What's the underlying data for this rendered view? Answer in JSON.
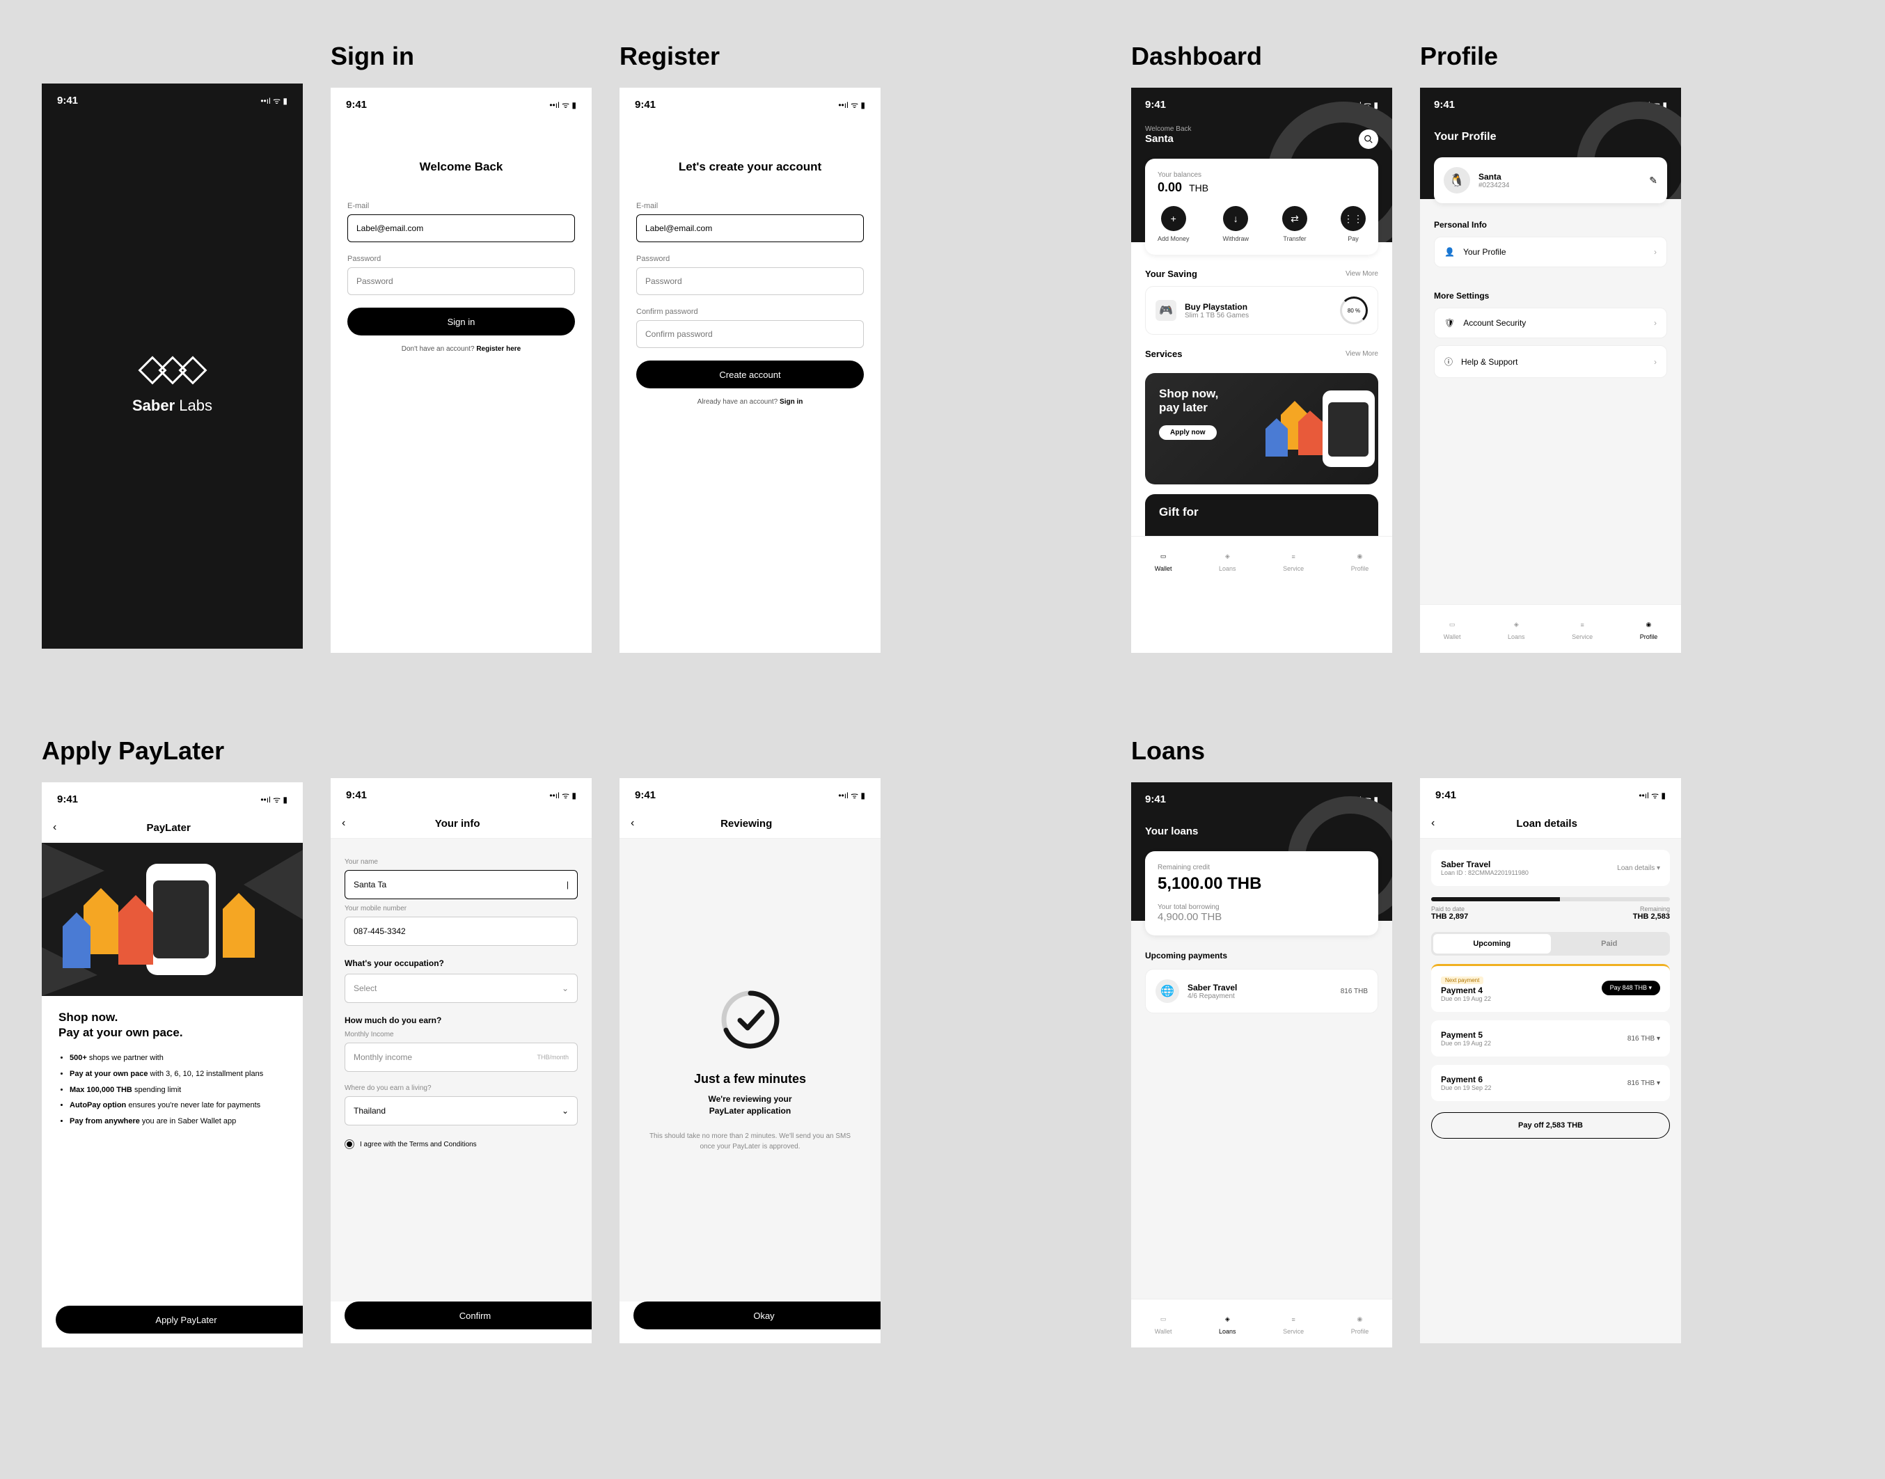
{
  "status": {
    "time": "9:41",
    "icons": "􀙇 􀛨"
  },
  "splash": {
    "brand": "Saber",
    "brand2": "Labs"
  },
  "titles": {
    "signin": "Sign in",
    "register": "Register",
    "dashboard": "Dashboard",
    "profile": "Profile",
    "applyPL": "Apply PayLater",
    "loans": "Loans"
  },
  "signin": {
    "heading": "Welcome Back",
    "email_label": "E-mail",
    "email_value": "Label@email.com",
    "password_label": "Password",
    "password_placeholder": "Password",
    "submit": "Sign in",
    "hint": "Don't have an account? ",
    "hint_link": "Register here"
  },
  "register": {
    "heading": "Let's create your account",
    "email_label": "E-mail",
    "email_value": "Label@email.com",
    "password_label": "Password",
    "password_placeholder": "Password",
    "confirm_label": "Confirm password",
    "confirm_placeholder": "Confirm password",
    "submit": "Create account",
    "hint": "Already have an account? ",
    "hint_link": "Sign in"
  },
  "dashboard": {
    "welcome": "Welcome Back",
    "name": "Santa",
    "balance_label": "Your balances",
    "balance": "0.00",
    "currency": "THB",
    "actions": [
      {
        "icon": "+",
        "label": "Add Money"
      },
      {
        "icon": "↓",
        "label": "Withdraw"
      },
      {
        "icon": "⇄",
        "label": "Transfer"
      },
      {
        "icon": "⋮⋮",
        "label": "Pay"
      }
    ],
    "saving_title": "Your Saving",
    "view_more": "View More",
    "saving": {
      "name": "Buy Playstation",
      "sub": "Slim 1 TB 56 Games",
      "pct": "80 %"
    },
    "services_title": "Services",
    "banner_line1": "Shop now,",
    "banner_line2": "pay later",
    "banner_cta": "Apply now",
    "banner2_title": "Gift for",
    "nav": [
      "Wallet",
      "Loans",
      "Service",
      "Profile"
    ],
    "nav_active": 0
  },
  "profile": {
    "title": "Your Profile",
    "name": "Santa",
    "id": "#0234234",
    "personal_title": "Personal Info",
    "item1": "Your Profile",
    "more_title": "More Settings",
    "item2": "Account Security",
    "item3": "Help & Support",
    "nav_active": 3
  },
  "paylater_intro": {
    "page": "PayLater",
    "h1": "Shop now.",
    "h2": "Pay at your own pace.",
    "bullets": [
      {
        "lead": "500+",
        "rest": " shops we partner with"
      },
      {
        "lead": "Pay at your own pace",
        "rest": " with 3, 6, 10, 12 installment plans"
      },
      {
        "lead": "Max 100,000 THB",
        "rest": " spending limit"
      },
      {
        "lead": "AutoPay option",
        "rest": " ensures you're never late for payments"
      },
      {
        "lead": "Pay from anywhere",
        "rest": " you are in Saber Wallet app"
      }
    ],
    "cta": "Apply PayLater"
  },
  "your_info": {
    "page": "Your info",
    "name_label": "Your name",
    "name_value": "Santa Ta",
    "mobile_label": "Your mobile number",
    "mobile_value": "087-445-3342",
    "q1": "What's your occupation?",
    "q1_placeholder": "Select",
    "q2": "How much do you earn?",
    "income_label": "Monthly Income",
    "income_placeholder": "Monthly income",
    "income_suffix": "THB/month",
    "q3": "Where do you earn a living?",
    "country": "Thailand",
    "terms": "I agree with the Terms and Conditions",
    "cta": "Confirm"
  },
  "reviewing": {
    "page": "Reviewing",
    "h": "Just a few minutes",
    "sub1": "We're reviewing your",
    "sub2": "PayLater application",
    "txt": "This should take no more than 2 minutes. We'll send you an SMS once your PayLater is approved.",
    "cta": "Okay"
  },
  "loans": {
    "title": "Your loans",
    "credit_label": "Remaining credit",
    "credit": "5,100.00 THB",
    "borrow_label": "Your total borrowing",
    "borrow": "4,900.00 THB",
    "upcoming_title": "Upcoming payments",
    "item_name": "Saber Travel",
    "item_sub": "4/6 Repayment",
    "item_amt": "816 THB",
    "nav_active": 1
  },
  "loan_details": {
    "page": "Loan details",
    "merchant": "Saber Travel",
    "loan_id": "Loan ID : 82CMMA2201911980",
    "dropdown": "Loan details ▾",
    "paid_lbl": "Paid to date",
    "paid": "THB 2,897",
    "remain_lbl": "Remaining",
    "remain": "THB 2,583",
    "tab_upcoming": "Upcoming",
    "tab_paid": "Paid",
    "payments": [
      {
        "badge": "Next payment",
        "name": "Payment 4",
        "due": "Due on 19 Aug 22",
        "btn": "Pay 848 THB",
        "active": true
      },
      {
        "name": "Payment 5",
        "due": "Due on 19 Aug 22",
        "amt": "816 THB ▾"
      },
      {
        "name": "Payment 6",
        "due": "Due on 19 Sep 22",
        "amt": "816 THB ▾"
      }
    ],
    "payoff": "Pay off 2,583 THB"
  }
}
